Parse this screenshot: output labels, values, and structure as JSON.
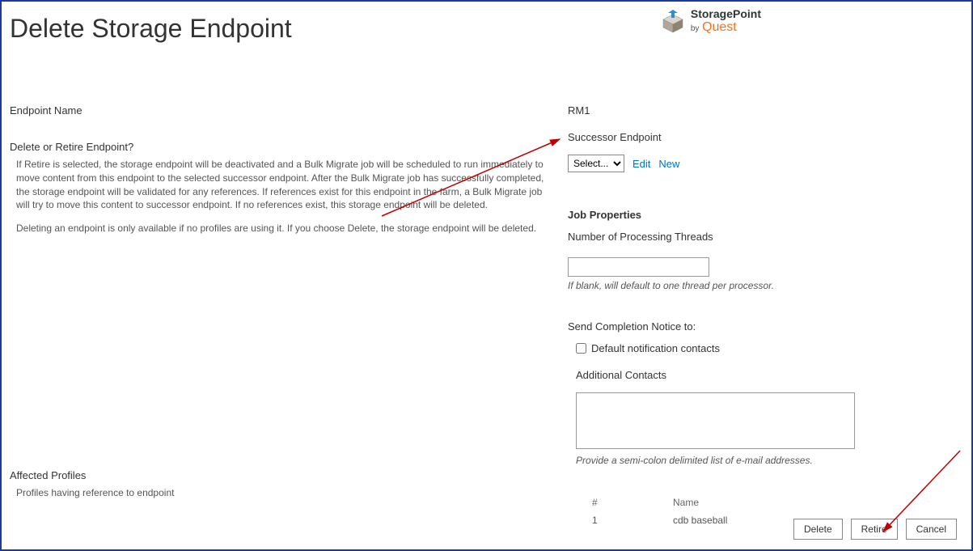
{
  "page_title": "Delete Storage Endpoint",
  "logo": {
    "product": "StoragePoint",
    "by": "by",
    "company": "Quest"
  },
  "left": {
    "endpoint_name_label": "Endpoint Name",
    "delete_retire_label": "Delete or Retire Endpoint?",
    "retire_help": "If Retire is selected, the storage endpoint will be deactivated and a Bulk Migrate job will be scheduled to run immediately to move content from this endpoint to the selected successor endpoint. After the Bulk Migrate job has successfully completed, the storage endpoint will be validated for any references. If references exist for this endpoint in the farm, a Bulk Migrate job will try to move this content to successor endpoint. If no references exist, this storage endpoint will be deleted.",
    "delete_help": "Deleting an endpoint is only available if no profiles are using it. If you choose Delete, the storage endpoint will be deleted.",
    "affected_profiles_label": "Affected Profiles",
    "affected_profiles_help": "Profiles having reference to endpoint"
  },
  "right": {
    "endpoint_name_value": "RM1",
    "successor_label": "Successor Endpoint",
    "successor_select_value": "Select...",
    "edit_link": "Edit",
    "new_link": "New",
    "job_properties_heading": "Job Properties",
    "threads_label": "Number of Processing Threads",
    "threads_value": "",
    "threads_hint": "If blank, will default to one thread per processor.",
    "completion_label": "Send Completion Notice to:",
    "default_contacts_checkbox_label": "Default notification contacts",
    "default_contacts_checked": false,
    "additional_contacts_label": "Additional Contacts",
    "additional_contacts_value": "",
    "additional_contacts_hint": "Provide a semi-colon delimited list of e-mail addresses."
  },
  "profiles_table": {
    "header_num": "#",
    "header_name": "Name",
    "rows": [
      {
        "num": "1",
        "name": "cdb baseball"
      }
    ]
  },
  "buttons": {
    "delete": "Delete",
    "retire": "Retire",
    "cancel": "Cancel"
  }
}
